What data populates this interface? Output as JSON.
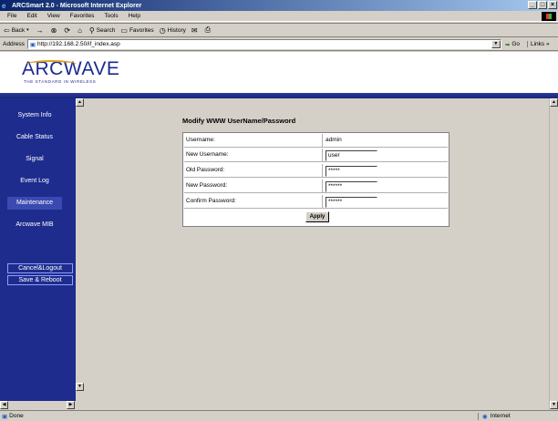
{
  "window": {
    "title": "ARCSmart 2.0 - Microsoft Internet Explorer",
    "buttons": [
      "_",
      "□",
      "×"
    ]
  },
  "menu": [
    "File",
    "Edit",
    "View",
    "Favorites",
    "Tools",
    "Help"
  ],
  "toolbar": {
    "back": "Back",
    "search": "Search",
    "favorites": "Favorites",
    "history": "History"
  },
  "address": {
    "label": "Address",
    "url": "http://192.168.2.50/if_index.asp",
    "go": "Go",
    "links": "Links"
  },
  "logo": {
    "word": "ARCWAVE",
    "tagline": "THE STANDARD IN WIRELESS"
  },
  "sidebar": {
    "items": [
      {
        "label": "System Info"
      },
      {
        "label": "Cable Status"
      },
      {
        "label": "Signal"
      },
      {
        "label": "Event Log"
      },
      {
        "label": "Maintenance"
      },
      {
        "label": "Arcwave MIB"
      }
    ],
    "actions": [
      {
        "label": "Cancel&Logout"
      },
      {
        "label": "Save & Reboot"
      }
    ]
  },
  "form": {
    "title": "Modify WWW UserName/Password",
    "username_label": "Username:",
    "username_value": "admin",
    "new_username_label": "New Username:",
    "new_username_value": "user",
    "old_password_label": "Old Password:",
    "old_password_value": "*****",
    "new_password_label": "New Password:",
    "new_password_value": "******",
    "confirm_password_label": "Confirm Password:",
    "confirm_password_value": "******",
    "apply_label": "Apply"
  },
  "status": {
    "left": "Done",
    "zone": "Internet"
  },
  "colors": {
    "sidebar": "#1e2c8e",
    "brand": "#1c2a8f",
    "content_bg": "#d4d0c8"
  }
}
